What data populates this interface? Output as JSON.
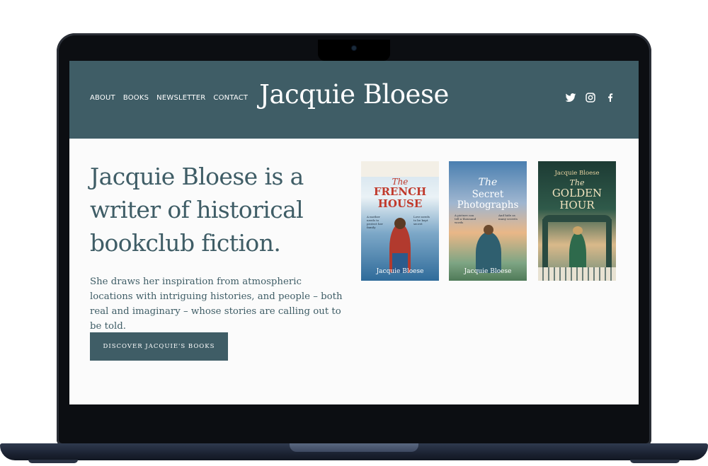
{
  "header": {
    "site_title": "Jacquie Bloese",
    "nav": [
      "ABOUT",
      "BOOKS",
      "NEWSLETTER",
      "CONTACT"
    ],
    "social_icons": [
      "twitter-icon",
      "instagram-icon",
      "facebook-icon"
    ]
  },
  "hero": {
    "heading": "Jacquie Bloese is a writer of historical bookclub fiction.",
    "text": "She draws her inspiration from atmospheric locations with intriguing histories, and people – both real and imaginary – whose stories are calling out to be told.",
    "cta_label": "DISCOVER JACQUIE'S BOOKS"
  },
  "books": [
    {
      "title_a": "The",
      "title_b": "FRENCH HOUSE",
      "author": "Jacquie Bloese",
      "tagline_left": "A mother needs to protect her family",
      "tagline_right": "Love needs to be kept secret"
    },
    {
      "title_a": "The",
      "title_b": "Secret Photographs",
      "author": "Jacquie Bloese",
      "tagline_left": "A picture can tell a thousand words",
      "tagline_right": "And hide as many secrets"
    },
    {
      "title_a": "The",
      "title_b": "GOLDEN HOUR",
      "author": "Jacquie Bloese",
      "tagline_left": "",
      "tagline_right": ""
    }
  ],
  "colors": {
    "brand": "#3f5d66",
    "background": "#fbfbfb",
    "text_on_brand": "#ffffff"
  }
}
